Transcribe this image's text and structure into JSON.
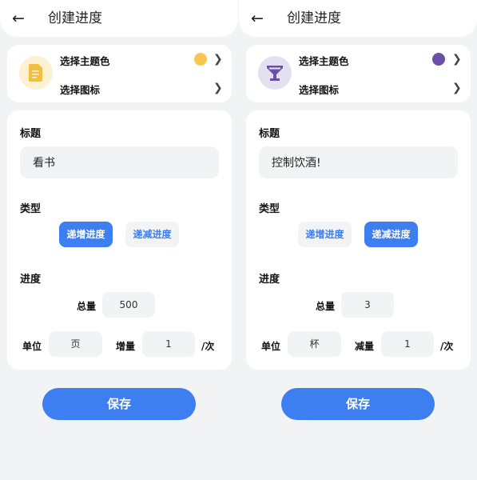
{
  "screens": [
    {
      "header": {
        "title": "创建进度",
        "back_icon": "arrow-left-icon"
      },
      "theme": {
        "color_label": "选择主题色",
        "color_hex": "#f9c74f",
        "icon_label": "选择图标",
        "icon_name": "document-icon",
        "icon_bg": "#fdf1d3",
        "icon_color": "#f2bf3e"
      },
      "form": {
        "title_label": "标题",
        "title_value": "看书",
        "type_label": "类型",
        "type_options": [
          "递增进度",
          "递减进度"
        ],
        "type_selected": "递增进度",
        "progress_label": "进度",
        "total_label": "总量",
        "total_value": "500",
        "unit_label": "单位",
        "unit_value": "页",
        "step_label": "增量",
        "step_value": "1",
        "per_label": "/次"
      },
      "save_label": "保存"
    },
    {
      "header": {
        "title": "创建进度",
        "back_icon": "arrow-left-icon"
      },
      "theme": {
        "color_label": "选择主题色",
        "color_hex": "#6a50a7",
        "icon_label": "选择图标",
        "icon_name": "wine-glass-icon",
        "icon_bg": "#e5e0ef",
        "icon_color": "#6a50a7"
      },
      "form": {
        "title_label": "标题",
        "title_value": "控制饮酒!",
        "type_label": "类型",
        "type_options": [
          "递增进度",
          "递减进度"
        ],
        "type_selected": "递减进度",
        "progress_label": "进度",
        "total_label": "总量",
        "total_value": "3",
        "unit_label": "单位",
        "unit_value": "杯",
        "step_label": "减量",
        "step_value": "1",
        "per_label": "/次"
      },
      "save_label": "保存"
    }
  ]
}
